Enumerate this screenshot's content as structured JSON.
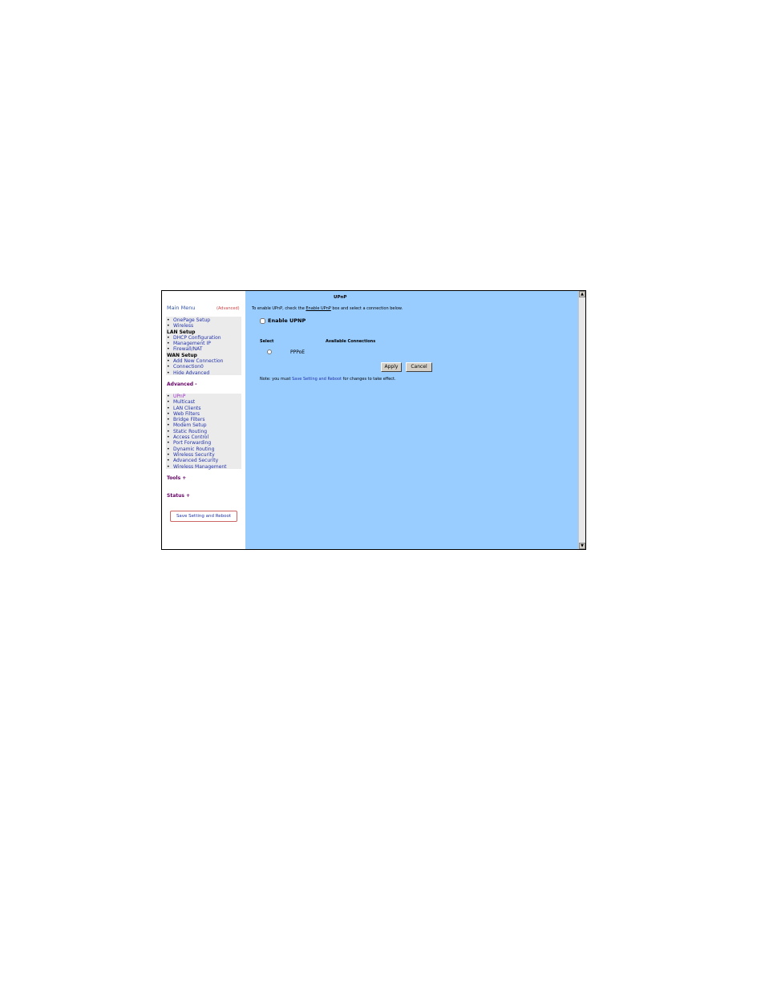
{
  "sidebar": {
    "main_menu": "Main Menu",
    "advanced_link": "(Advanced)",
    "menu1": [
      {
        "label": "OnePage Setup",
        "kind": "item"
      },
      {
        "label": "Wireless",
        "kind": "item"
      },
      {
        "label": "LAN Setup",
        "kind": "head"
      },
      {
        "label": "DHCP Configuration",
        "kind": "item"
      },
      {
        "label": "Management IP",
        "kind": "item"
      },
      {
        "label": "Firewall/NAT",
        "kind": "item"
      },
      {
        "label": "WAN Setup",
        "kind": "head"
      },
      {
        "label": "Add New Connection",
        "kind": "item"
      },
      {
        "label": "Connection0",
        "kind": "item"
      },
      {
        "label": "Hide Advanced",
        "kind": "item"
      }
    ],
    "advanced_section": "Advanced -",
    "menu2": [
      {
        "label": "UPnP",
        "kind": "active"
      },
      {
        "label": "Multicast",
        "kind": "item"
      },
      {
        "label": "LAN Clients",
        "kind": "item"
      },
      {
        "label": "Web Filters",
        "kind": "item"
      },
      {
        "label": "Bridge Filters",
        "kind": "item"
      },
      {
        "label": "Modem Setup",
        "kind": "item"
      },
      {
        "label": "Static Routing",
        "kind": "item"
      },
      {
        "label": "Access Control",
        "kind": "item"
      },
      {
        "label": "Port Forwarding",
        "kind": "item"
      },
      {
        "label": "Dynamic Routing",
        "kind": "item"
      },
      {
        "label": "Wireless Security",
        "kind": "item"
      },
      {
        "label": "Advanced Security",
        "kind": "item"
      },
      {
        "label": "Wireless Management",
        "kind": "item"
      }
    ],
    "tools_section": "Tools +",
    "status_section": "Status +",
    "save_button": "Save Setting and Reboot"
  },
  "main": {
    "title": "UPnP",
    "instructions_pre": "To enable UPnP, check the ",
    "instructions_link": "Enable UPnP",
    "instructions_post": " box and select a connection below.",
    "enable_label": "Enable UPNP",
    "col_select": "Select",
    "col_available": "Available Connections",
    "connection": "PPPoE",
    "apply": "Apply",
    "cancel": "Cancel",
    "note_pre": "Note: you must ",
    "note_link": "Save Setting and Reboot",
    "note_post": " for changes to take effect."
  }
}
